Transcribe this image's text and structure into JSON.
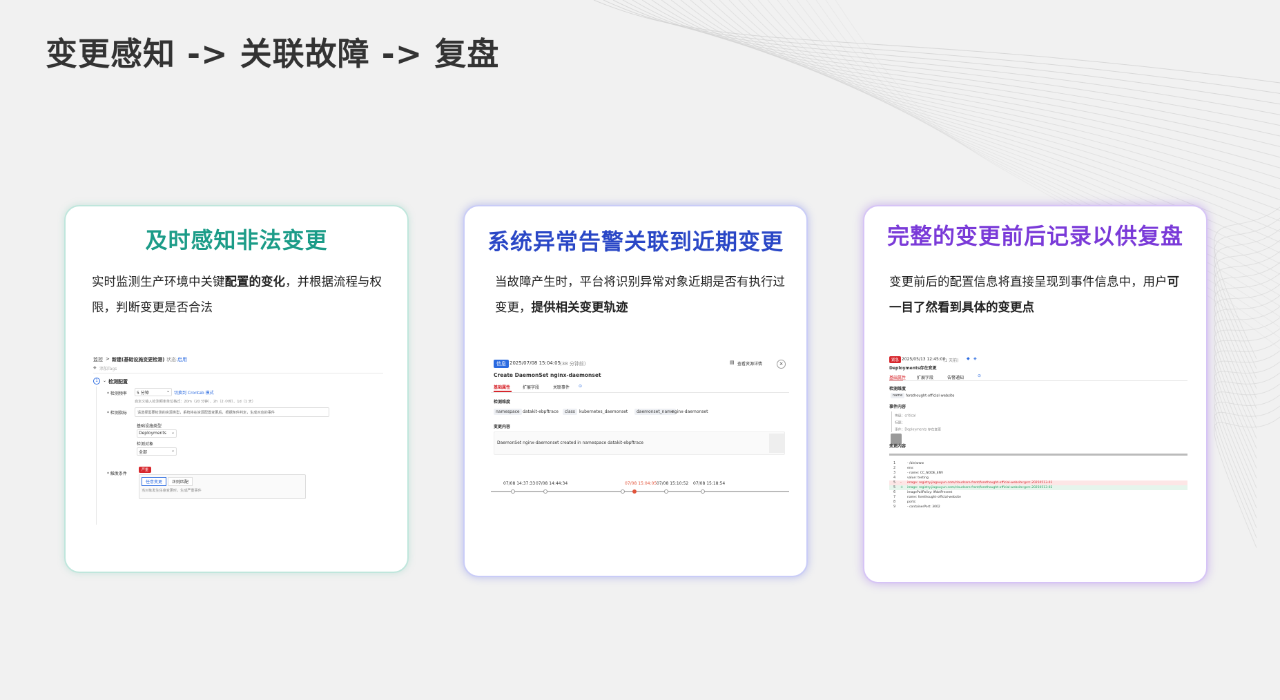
{
  "page": {
    "title": "变更感知 -> 关联故障 -> 复盘"
  },
  "colors": {
    "card1_accent": "#1c9c88",
    "card2_accent": "#2a47c6",
    "card3_accent": "#7a3ad8",
    "alert_red": "#d7262c"
  },
  "cards": [
    {
      "title": "及时感知非法变更",
      "desc_pre": "实时监测生产环境中关键",
      "desc_bold": "配置的变化",
      "desc_post": "，并根据流程与权限，判断变更是否合法",
      "screenshot": {
        "breadcrumb_1": "监控",
        "breadcrumb_sep": ">",
        "breadcrumb_2": "新建(基础设施变更检测)",
        "status_label": "状态:",
        "status_value": "启用",
        "tag_hint": "添加Tags",
        "section": "检测配置",
        "freq_label": "* 检测频率",
        "freq_value": "5 分钟",
        "freq_link": "切换到 Crontab 模式",
        "freq_hint": "自定义输入检测频率单位格式：20m（20 分钟）、2h（2 小时）、1d（1 天）",
        "metric_label": "* 检测指标",
        "metric_value": "请选择需要检测的资源类型，系统将在资源配置变更后，根据条件判定，生成对应的事件",
        "object_type_label": "基础设施类型",
        "object_type_value": "Deployments",
        "object_label": "检测对象",
        "object_value": "全部",
        "trigger_label": "* 触发条件",
        "trigger_badge": "严重",
        "trigger_opt_1": "任意变更",
        "trigger_opt_2": "正则匹配",
        "trigger_hint": "当对象发生任意变更时，生成严重事件"
      }
    },
    {
      "title": "系统异常告警关联到近期变更",
      "desc_pre": "当故障产生时，平台将识别异常对象近期是否有执行过变更，",
      "desc_bold": "提供相关变更轨迹",
      "desc_post": "",
      "screenshot": {
        "level_badge": "信息",
        "time": "2025/07/08 15:04:05",
        "ago": "(38 分钟前)",
        "view_link": "查看资源详情",
        "close": "×",
        "event_title": "Create DaemonSet nginx-daemonset",
        "tabs": [
          "基础属性",
          "扩展字段",
          "关联事件"
        ],
        "dim_title": "检测维度",
        "dims": [
          {
            "key": "namespace",
            "value": "datakit-ebpftrace"
          },
          {
            "key": "class",
            "value": "kubernetes_daemonset"
          },
          {
            "key": "daemonset_name",
            "value": "nginx-daemonset"
          }
        ],
        "content_title": "变更内容",
        "content": "DaemonSet nginx-daemonset created in namespace datakit-ebpftrace",
        "timeline": [
          "07/08 14:37:33",
          "07/08 14:44:34",
          "07/08 15:04:05",
          "07/08 15:10:52",
          "07/08 15:18:54"
        ],
        "timeline_active_index": 2
      }
    },
    {
      "title": "完整的变更前后记录以供复盘",
      "desc_pre": "变更前后的配置信息将直接呈现到事件信息中，用户",
      "desc_bold": "可一目了然看到具体的变更点",
      "desc_post": "",
      "screenshot": {
        "level_badge": "紧急",
        "time": "2025/05/13 12:45:00",
        "ago": "(1 天前)",
        "event_title": "Deployments存在变更",
        "tabs": [
          "基础属性",
          "扩展字段",
          "告警通知"
        ],
        "dim_title": "检测维度",
        "dim_key": "name",
        "dim_value": "forethought-official-website",
        "content_title": "事件内容",
        "content_lines": [
          "等级：critical",
          "标题：",
          "事件：Deployments 存在变更"
        ],
        "change_title": "变更内容",
        "diff": [
          {
            "n": "1",
            "mark": "",
            "text": "- /bin/www"
          },
          {
            "n": "2",
            "mark": "",
            "text": "env:"
          },
          {
            "n": "3",
            "mark": "",
            "text": "- name: CC_NODE_ENV"
          },
          {
            "n": "4",
            "mark": "",
            "text": "value: testing"
          },
          {
            "n": "5",
            "mark": "-",
            "text": "image: registry.jiagouyun.com/cloudcare-front/forethought-official-website:gcrc.20250513-01"
          },
          {
            "n": "5",
            "mark": "+",
            "text": "image: registry.jiagouyun.com/cloudcare-front/forethought-official-website:gcrc.20250513-02"
          },
          {
            "n": "6",
            "mark": "",
            "text": "imagePullPolicy: IfNotPresent"
          },
          {
            "n": "7",
            "mark": "",
            "text": "name: forethought-official-website"
          },
          {
            "n": "8",
            "mark": "",
            "text": "ports:"
          },
          {
            "n": "9",
            "mark": "",
            "text": "- containerPort: 3002"
          }
        ]
      }
    }
  ]
}
